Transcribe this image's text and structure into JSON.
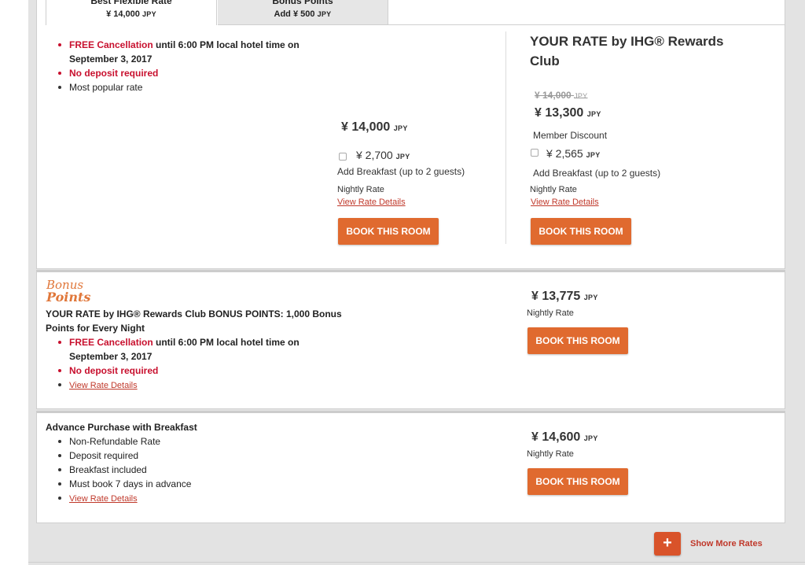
{
  "tabs": [
    {
      "title": "Best Flexible Rate",
      "sub_prefix": "",
      "amount": "¥ 14,000",
      "currency": "JPY"
    },
    {
      "title": "Bonus Points",
      "sub_prefix": "Add",
      "amount": "¥ 500",
      "currency": "JPY"
    }
  ],
  "currency_label": "JPY",
  "rate1": {
    "features": {
      "cancel_lead": "FREE Cancellation",
      "cancel_rest_1": " until 6:00 PM local hotel time on",
      "cancel_rest_2": "September 3, 2017",
      "no_deposit": "No deposit required",
      "popular": "Most popular rate"
    },
    "standard": {
      "price": "¥ 14,000",
      "breakfast_price": "¥ 2,700",
      "breakfast_label": "Add Breakfast (up to 2 guests)",
      "nightly": "Nightly Rate",
      "details": "View Rate Details",
      "book": "BOOK THIS ROOM"
    },
    "member": {
      "heading_1": "YOUR RATE by IHG® Rewards",
      "heading_2": "Club",
      "old_price": "¥ 14,000",
      "price": "¥ 13,300",
      "discount": "Member Discount",
      "breakfast_price": "¥ 2,565",
      "breakfast_label": "Add Breakfast (up to 2 guests)",
      "nightly": "Nightly Rate",
      "details": "View Rate Details",
      "book": "BOOK THIS ROOM"
    }
  },
  "rate2": {
    "logo_1": "Bonus",
    "logo_2": "Points",
    "title_1": "YOUR RATE by IHG® Rewards Club BONUS POINTS: 1,000 Bonus",
    "title_2": "Points for Every Night",
    "cancel_lead": "FREE Cancellation",
    "cancel_rest_1": " until 6:00 PM local hotel time on",
    "cancel_rest_2": "September 3, 2017",
    "no_deposit": "No deposit required",
    "details": "View Rate Details",
    "price": "¥ 13,775",
    "nightly": "Nightly Rate",
    "book": "BOOK THIS ROOM"
  },
  "rate3": {
    "title": "Advance Purchase with Breakfast",
    "features": [
      "Non-Refundable Rate",
      "Deposit required",
      "Breakfast included",
      "Must book 7 days in advance"
    ],
    "details": "View Rate Details",
    "price": "¥ 14,600",
    "nightly": "Nightly Rate",
    "book": "BOOK THIS ROOM"
  },
  "show_more": {
    "icon": "plus-icon",
    "label": "Show More Rates"
  },
  "colors": {
    "accent": "#e06a2f",
    "red": "#c8102e",
    "link": "#c0392b",
    "bonus": "#e0773a"
  }
}
